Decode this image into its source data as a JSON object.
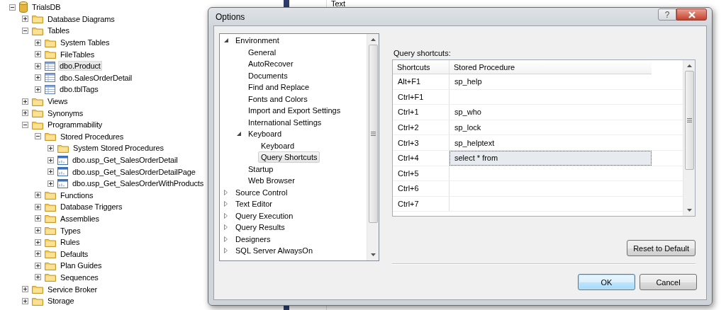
{
  "explorer": {
    "items": [
      {
        "label": "TrialsDB",
        "kind": "database",
        "expanded": true,
        "selected": false,
        "children": [
          {
            "label": "Database Diagrams",
            "kind": "folder",
            "expanded": false,
            "selected": false
          },
          {
            "label": "Tables",
            "kind": "folder",
            "expanded": true,
            "selected": false,
            "children": [
              {
                "label": "System Tables",
                "kind": "folder",
                "expanded": false,
                "selected": false
              },
              {
                "label": "FileTables",
                "kind": "folder",
                "expanded": false,
                "selected": false
              },
              {
                "label": "dbo.Product",
                "kind": "table",
                "expanded": false,
                "selected": true
              },
              {
                "label": "dbo.SalesOrderDetail",
                "kind": "table",
                "expanded": false,
                "selected": false
              },
              {
                "label": "dbo.tblTags",
                "kind": "table",
                "expanded": false,
                "selected": false
              }
            ]
          },
          {
            "label": "Views",
            "kind": "folder",
            "expanded": false,
            "selected": false
          },
          {
            "label": "Synonyms",
            "kind": "folder",
            "expanded": false,
            "selected": false
          },
          {
            "label": "Programmability",
            "kind": "folder",
            "expanded": true,
            "selected": false,
            "children": [
              {
                "label": "Stored Procedures",
                "kind": "folder",
                "expanded": true,
                "selected": false,
                "children": [
                  {
                    "label": "System Stored Procedures",
                    "kind": "folder",
                    "expanded": false,
                    "selected": false
                  },
                  {
                    "label": "dbo.usp_Get_SalesOrderDetail",
                    "kind": "procedure",
                    "expanded": false,
                    "selected": false
                  },
                  {
                    "label": "dbo.usp_Get_SalesOrderDetailPage",
                    "kind": "procedure",
                    "expanded": false,
                    "selected": false
                  },
                  {
                    "label": "dbo.usp_Get_SalesOrderWithProducts",
                    "kind": "procedure",
                    "expanded": false,
                    "selected": false
                  }
                ]
              },
              {
                "label": "Functions",
                "kind": "folder",
                "expanded": false,
                "selected": false
              },
              {
                "label": "Database Triggers",
                "kind": "folder",
                "expanded": false,
                "selected": false
              },
              {
                "label": "Assemblies",
                "kind": "folder",
                "expanded": false,
                "selected": false
              },
              {
                "label": "Types",
                "kind": "folder",
                "expanded": false,
                "selected": false
              },
              {
                "label": "Rules",
                "kind": "folder",
                "expanded": false,
                "selected": false
              },
              {
                "label": "Defaults",
                "kind": "folder",
                "expanded": false,
                "selected": false
              },
              {
                "label": "Plan Guides",
                "kind": "folder",
                "expanded": false,
                "selected": false
              },
              {
                "label": "Sequences",
                "kind": "folder",
                "expanded": false,
                "selected": false
              }
            ]
          },
          {
            "label": "Service Broker",
            "kind": "folder",
            "expanded": false,
            "selected": false
          },
          {
            "label": "Storage",
            "kind": "folder",
            "expanded": false,
            "selected": false
          }
        ]
      }
    ]
  },
  "editor": {
    "column_header": "Text"
  },
  "dialog": {
    "title": "Options",
    "help_button": "?",
    "nav": [
      {
        "label": "Environment",
        "expanded": true,
        "selected": false,
        "children": [
          {
            "label": "General",
            "selected": false
          },
          {
            "label": "AutoRecover",
            "selected": false
          },
          {
            "label": "Documents",
            "selected": false
          },
          {
            "label": "Find and Replace",
            "selected": false
          },
          {
            "label": "Fonts and Colors",
            "selected": false
          },
          {
            "label": "Import and Export Settings",
            "selected": false
          },
          {
            "label": "International Settings",
            "selected": false
          },
          {
            "label": "Keyboard",
            "expanded": true,
            "selected": false,
            "children": [
              {
                "label": "Keyboard",
                "selected": false
              },
              {
                "label": "Query Shortcuts",
                "selected": true
              }
            ]
          },
          {
            "label": "Startup",
            "selected": false
          },
          {
            "label": "Web Browser",
            "selected": false
          }
        ]
      },
      {
        "label": "Source Control",
        "expanded": false,
        "selected": false
      },
      {
        "label": "Text Editor",
        "expanded": false,
        "selected": false
      },
      {
        "label": "Query Execution",
        "expanded": false,
        "selected": false
      },
      {
        "label": "Query Results",
        "expanded": false,
        "selected": false
      },
      {
        "label": "Designers",
        "expanded": false,
        "selected": false
      },
      {
        "label": "SQL Server AlwaysOn",
        "expanded": false,
        "selected": false
      }
    ],
    "section_label": "Query shortcuts:",
    "table": {
      "columns": [
        "Shortcuts",
        "Stored Procedure"
      ],
      "rows": [
        {
          "shortcut": "Alt+F1",
          "procedure": "sp_help",
          "selected": false
        },
        {
          "shortcut": "Ctrl+F1",
          "selected": false
        },
        {
          "shortcut": "Ctrl+1",
          "procedure": "sp_who",
          "selected": false
        },
        {
          "shortcut": "Ctrl+2",
          "procedure": "sp_lock",
          "selected": false
        },
        {
          "shortcut": "Ctrl+3",
          "procedure": "sp_helptext",
          "selected": false
        },
        {
          "shortcut": "Ctrl+4",
          "procedure": "select * from",
          "selected": true
        },
        {
          "shortcut": "Ctrl+5",
          "selected": false
        },
        {
          "shortcut": "Ctrl+6",
          "selected": false
        },
        {
          "shortcut": "Ctrl+7",
          "selected": false
        }
      ]
    },
    "reset_button": "Reset to Default",
    "ok_button": "OK",
    "cancel_button": "Cancel"
  }
}
